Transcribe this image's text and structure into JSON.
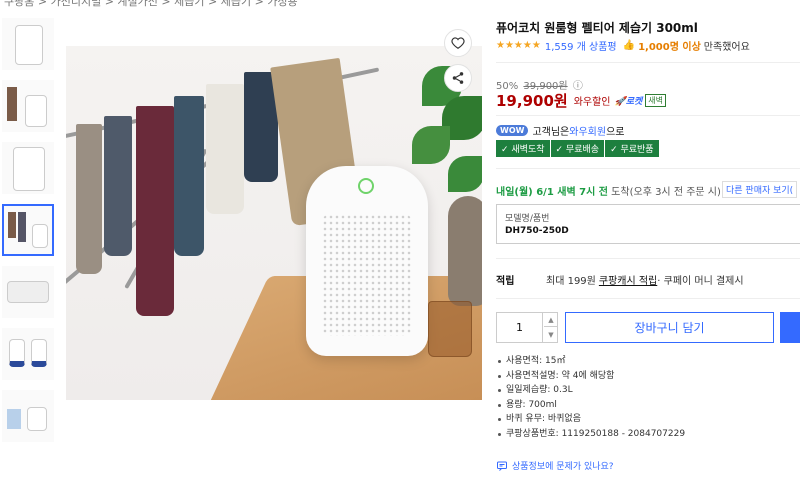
{
  "breadcrumb": [
    "쿠팡홈",
    "가전디지털",
    "계절가전",
    "제습기",
    "제습기",
    "가정용"
  ],
  "thumbnails": [
    {
      "label": "thumb-1"
    },
    {
      "label": "thumb-2"
    },
    {
      "label": "thumb-3"
    },
    {
      "label": "thumb-4"
    },
    {
      "label": "thumb-5"
    },
    {
      "label": "thumb-6"
    },
    {
      "label": "thumb-7"
    }
  ],
  "product": {
    "title": "퓨어코치 원룸형 펠티어 제습기 300ml",
    "stars": "★★★★★",
    "review_count": "1,559 개 상품평",
    "satisfied_count": "1,000명 이상",
    "satisfied_text": "만족했어요"
  },
  "price": {
    "discount_rate": "50%",
    "original_price": "39,900원",
    "info_icon": "ⓘ",
    "sale_price": "19,900원",
    "wow_discount": "와우할인",
    "rocket_label": "🚀로켓",
    "dawn_badge": "새벽"
  },
  "wow": {
    "pill": "WOW",
    "text_before": "고객님은 ",
    "member_text": "와우회원",
    "text_after": "으로",
    "benefits": [
      "✓ 새벽도착",
      "✓ 무료배송",
      "✓ 무료반품"
    ]
  },
  "delivery": {
    "date": "내일(월) 6/1 새벽 7시 전",
    "arrive": " 도착",
    "note": "(오후 3시 전 주문 시)",
    "other_sellers": "다른 판매자 보기("
  },
  "option": {
    "label": "모델명/품번",
    "value": "DH750-250D"
  },
  "rewards": {
    "label": "적립",
    "text": "최대 199원 ",
    "link": "쿠팡캐시 적립",
    "suffix": " · 쿠페이 머니 결제시"
  },
  "purchase": {
    "quantity": "1",
    "cart_label": "장바구니 담기"
  },
  "specs": [
    "사용면적: 15㎡",
    "사용면적설명: 약 4에 해당함",
    "일일제습량: 0.3L",
    "용량: 700ml",
    "바퀴 유무: 바퀴없음",
    "쿠팡상품번호: 1119250188 - 2084707229"
  ],
  "report": "상품정보에 문제가 있나요?",
  "colors": {
    "accent": "#346aff",
    "price": "#ae0000",
    "delivery": "#1d9c44",
    "benefit_bg": "#1d7f3e"
  },
  "icons": {
    "favorite": "heart-icon",
    "share": "share-icon",
    "report": "chat-icon"
  }
}
